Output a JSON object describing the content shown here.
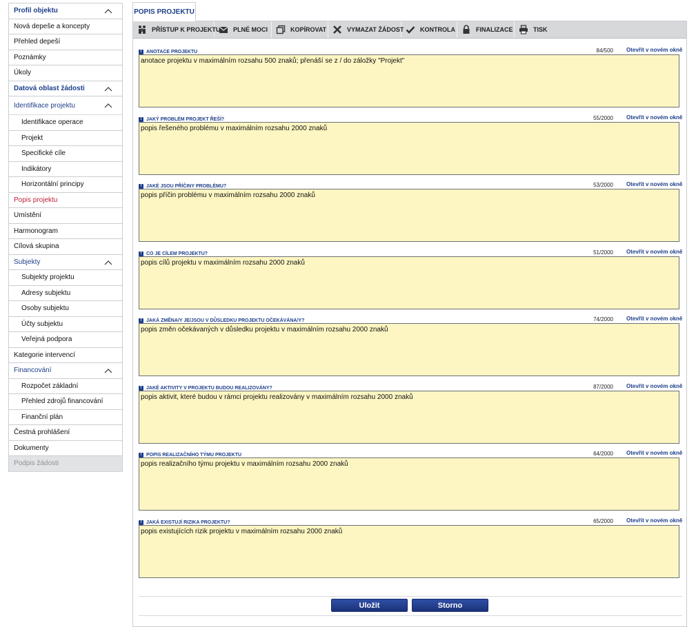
{
  "sidebar": {
    "items": [
      {
        "label": "Profil objektu",
        "type": "section",
        "expanded": true
      },
      {
        "label": "Nová depeše a koncepty",
        "type": "item"
      },
      {
        "label": "Přehled depeší",
        "type": "item"
      },
      {
        "label": "Poznámky",
        "type": "item"
      },
      {
        "label": "Úkoly",
        "type": "item"
      },
      {
        "label": "Datová oblast žádosti",
        "type": "section",
        "expanded": true
      },
      {
        "label": "Identifikace projektu",
        "type": "section-light",
        "expanded": true
      },
      {
        "label": "Identifikace operace",
        "type": "sub"
      },
      {
        "label": "Projekt",
        "type": "sub"
      },
      {
        "label": "Specifické cíle",
        "type": "sub"
      },
      {
        "label": "Indikátory",
        "type": "sub"
      },
      {
        "label": "Horizontální principy",
        "type": "sub"
      },
      {
        "label": "Popis projektu",
        "type": "active"
      },
      {
        "label": "Umístění",
        "type": "item"
      },
      {
        "label": "Harmonogram",
        "type": "item"
      },
      {
        "label": "Cílová skupina",
        "type": "item"
      },
      {
        "label": "Subjekty",
        "type": "section-light",
        "expanded": true
      },
      {
        "label": "Subjekty projektu",
        "type": "sub"
      },
      {
        "label": "Adresy subjektu",
        "type": "sub"
      },
      {
        "label": "Osoby subjektu",
        "type": "sub"
      },
      {
        "label": "Účty subjektu",
        "type": "sub"
      },
      {
        "label": "Veřejná podpora",
        "type": "sub"
      },
      {
        "label": "Kategorie intervencí",
        "type": "item"
      },
      {
        "label": "Financování",
        "type": "section-light",
        "expanded": true
      },
      {
        "label": "Rozpočet základní",
        "type": "sub"
      },
      {
        "label": "Přehled zdrojů financování",
        "type": "sub"
      },
      {
        "label": "Finanční plán",
        "type": "sub"
      },
      {
        "label": "Čestná prohlášení",
        "type": "item"
      },
      {
        "label": "Dokumenty",
        "type": "item"
      },
      {
        "label": "Podpis žádosti",
        "type": "disabled"
      }
    ]
  },
  "tab": {
    "label": "POPIS PROJEKTU"
  },
  "toolbar": {
    "buttons": [
      {
        "label": "PŘÍSTUP K PROJEKTU",
        "icon": "people-icon"
      },
      {
        "label": "PLNÉ MOCI",
        "icon": "envelope-icon"
      },
      {
        "label": "KOPÍROVAT",
        "icon": "copy-icon"
      },
      {
        "label": "VYMAZAT ŽÁDOST",
        "icon": "cross-icon"
      },
      {
        "label": "KONTROLA",
        "icon": "checkmark-icon"
      },
      {
        "label": "FINALIZACE",
        "icon": "lock-icon"
      },
      {
        "label": "TISK",
        "icon": "printer-icon"
      }
    ]
  },
  "fields": [
    {
      "label": "ANOTACE PROJEKTU",
      "count": "84/500",
      "link": "Otevřít v novém okně",
      "value": "anotace projektu v maximálním rozsahu 500 znaků; přenáší se z / do záložky \"Projekt\""
    },
    {
      "label": "JAKÝ PROBLÉM PROJEKT ŘEŠÍ?",
      "count": "55/2000",
      "link": "Otevřít v novém okně",
      "value": "popis řešeného problému v maximálním rozsahu 2000 znaků"
    },
    {
      "label": "JAKÉ JSOU PŘÍČINY PROBLÉMU?",
      "count": "53/2000",
      "link": "Otevřít v novém okně",
      "value": "popis příčin problému v maximálním rozsahu 2000 znaků"
    },
    {
      "label": "CO JE CÍLEM PROJEKTU?",
      "count": "51/2000",
      "link": "Otevřít v novém okně",
      "value": "popis cílů projektu v maximálním rozsahu 2000 znaků"
    },
    {
      "label": "JAKÁ ZMĚNA/Y JE/JSOU V DŮSLEDKU PROJEKTU OČEKÁVÁNA/Y?",
      "count": "74/2000",
      "link": "Otevřít v novém okně",
      "value": "popis změn očekávaných v důsledku projektu v maximálním rozsahu 2000 znaků"
    },
    {
      "label": "JAKÉ AKTIVITY V PROJEKTU BUDOU REALIZOVÁNY?",
      "count": "87/2000",
      "link": "Otevřít v novém okně",
      "value": "popis aktivit, které budou v rámci projektu realizovány v maximálním rozsahu 2000 znaků"
    },
    {
      "label": "POPIS REALIZAČNÍHO TÝMU PROJEKTU",
      "count": "64/2000",
      "link": "Otevřít v novém okně",
      "value": "popis realizačního týmu projektu v maximálním rozsahu 2000 znaků"
    },
    {
      "label": "JAKÁ EXISTUJÍ RIZIKA PROJEKTU?",
      "count": "65/2000",
      "link": "Otevřít v novém okně",
      "value": "popis existujících rizik projektu v maximálním rozsahu 2000 znaků"
    }
  ],
  "info_glyph": "!",
  "actions": {
    "save_label": "Uložit",
    "cancel_label": "Storno"
  },
  "colors": {
    "accent": "#1d3f8a",
    "active": "#c0213a",
    "field_bg": "#fdf6c2",
    "button": "#1b3278"
  }
}
